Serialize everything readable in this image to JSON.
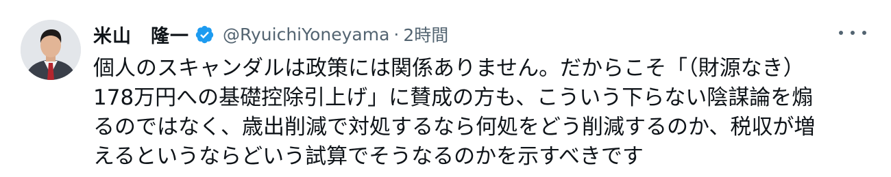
{
  "tweet": {
    "author_name": "米山　隆一",
    "handle": "@RyuichiYoneyama",
    "separator": "·",
    "time": "2時間",
    "verified_icon": "verified-badge-icon",
    "more_icon": "more-options-icon",
    "text_lines": [
      "個人のスキャンダルは政策には関係ありません。だからこそ「（財源なき）",
      "178万円への基礎控除引上げ」に賛成の方も、こういう下らない陰謀論を煽",
      "るのではなく、歳出削減で対処するなら何処をどう削減するのか、税収が増",
      "えるというならどいう試算でそうなるのかを示すべきです"
    ]
  },
  "colors": {
    "text": "#0f1419",
    "secondary": "#536471",
    "verified": "#1d9bf0"
  }
}
